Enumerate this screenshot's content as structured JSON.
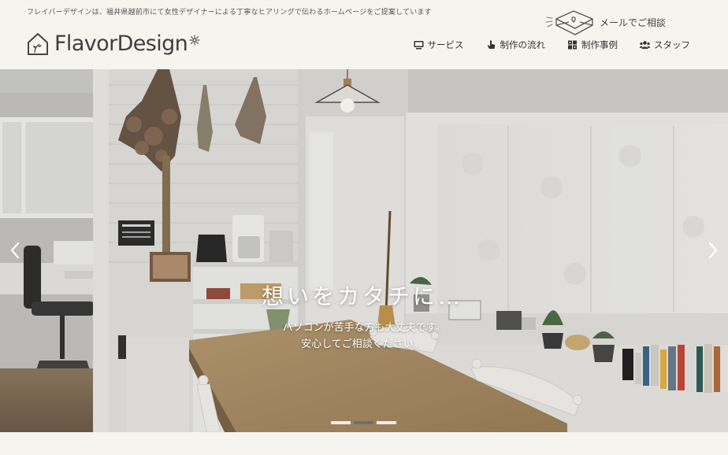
{
  "header": {
    "tagline": "フレイバーデザインは、福井県越前市にて女性デザイナーによる丁寧なヒアリングで伝わるホームページをご提案しています",
    "logo_text": "FlavorDesign",
    "contact_label": "メールでご相談",
    "nav": [
      {
        "label": "サービス",
        "icon": "monitor-icon"
      },
      {
        "label": "制作の流れ",
        "icon": "hand-pointer-icon"
      },
      {
        "label": "制作事例",
        "icon": "grid-icon"
      },
      {
        "label": "スタッフ",
        "icon": "users-icon"
      }
    ]
  },
  "hero": {
    "title": "想いをカタチに…",
    "subtitle_line1": "パソコンが苦手な方も大丈夫です。",
    "subtitle_line2": "安心してご相談ください。",
    "active_slide": 2,
    "slide_count": 3
  },
  "colors": {
    "background": "#f6f4ef",
    "text": "#3a3a3a",
    "active_dot": "#6e6e6e"
  }
}
